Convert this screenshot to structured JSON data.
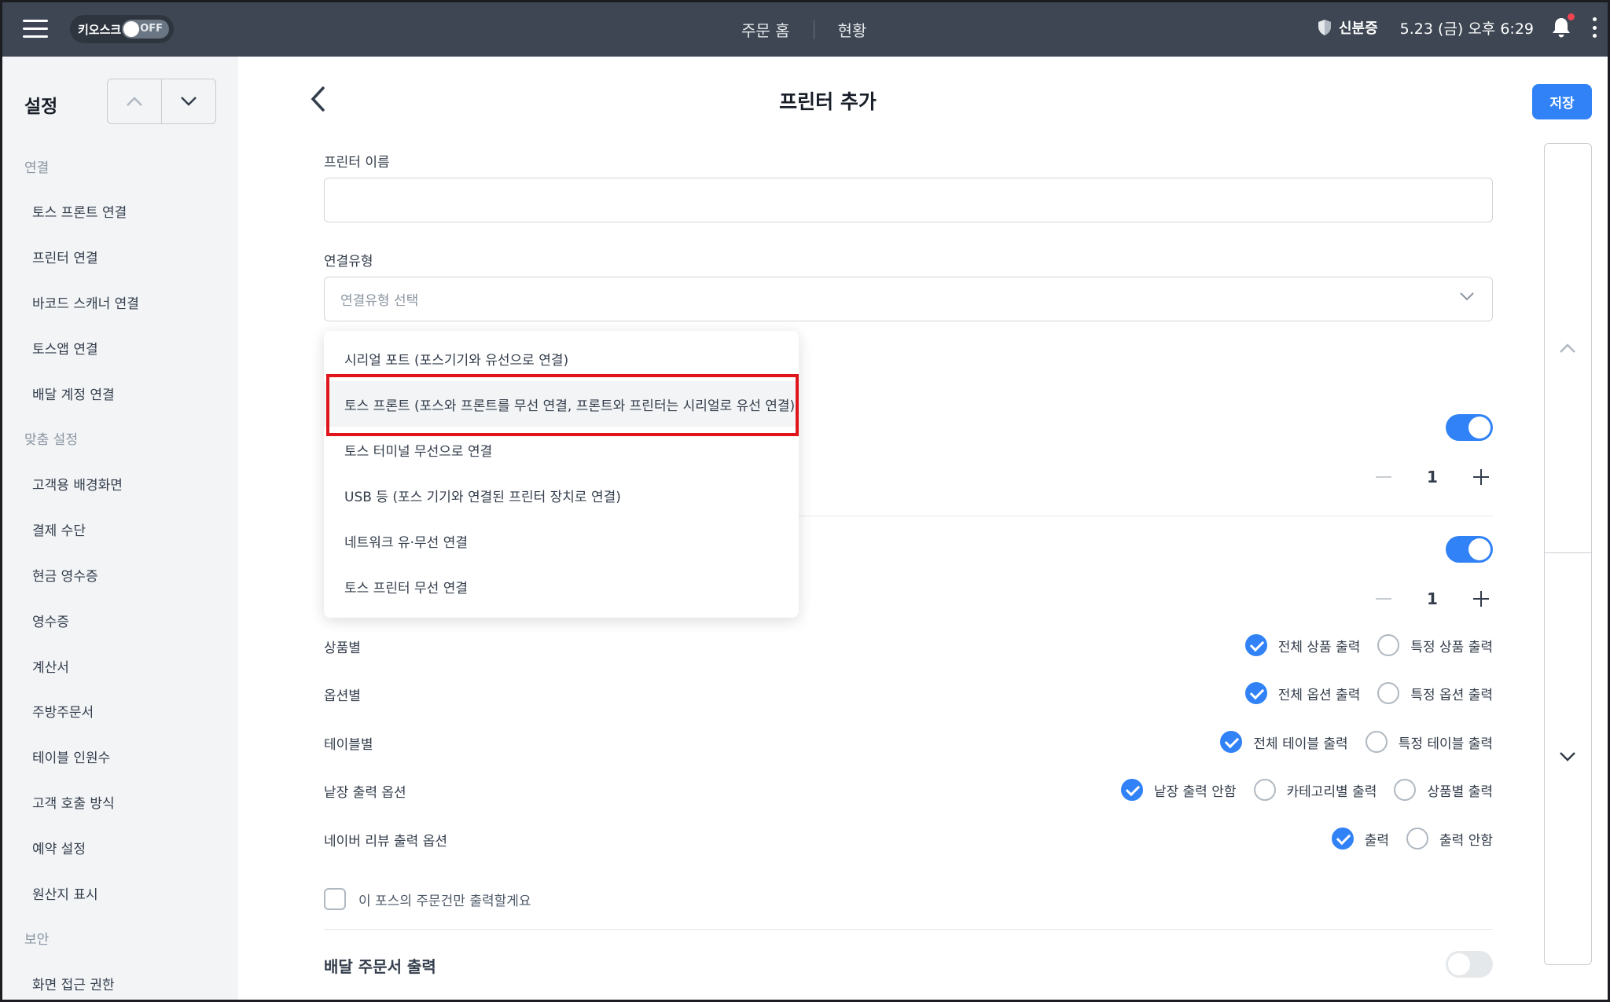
{
  "topbar": {
    "kiosk_label": "키오스크",
    "kiosk_state": "OFF",
    "nav": [
      "주문 홈",
      "현황"
    ],
    "id_verification": "신분증",
    "datetime": "5.23 (금) 오후 6:29"
  },
  "sidebar": {
    "title": "설정",
    "sections": [
      {
        "title": "연결",
        "items": [
          "토스 프론트 연결",
          "프린터 연결",
          "바코드 스캐너 연결",
          "토스앱 연결",
          "배달 계정 연결"
        ]
      },
      {
        "title": "맞춤 설정",
        "items": [
          "고객용 배경화면",
          "결제 수단",
          "현금 영수증",
          "영수증",
          "계산서",
          "주방주문서",
          "테이블 인원수",
          "고객 호출 방식",
          "예약 설정",
          "원산지 표시"
        ]
      },
      {
        "title": "보안",
        "items": [
          "화면 접근 권한"
        ]
      }
    ]
  },
  "main": {
    "title": "프린터 추가",
    "save_label": "저장",
    "printer_name_label": "프린터 이름",
    "printer_name_value": "",
    "connection_type_label": "연결유형",
    "connection_type_placeholder": "연결유형 선택",
    "dropdown_options": [
      "시리얼 포트 (포스기기와 유선으로 연결)",
      "토스 프론트 (포스와 프론트를 무선 연결, 프론트와 프린터는 시리얼로 유선 연결)",
      "토스 터미널 무선으로 연결",
      "USB 등 (포스 기기와 연결된 프린터 장치로 연결)",
      "네트워크 유·무선 연결",
      "토스 프린터 무선 연결"
    ],
    "highlighted_option_index": 1,
    "toggle_1_on": true,
    "stepper_1_value": "1",
    "toggle_2_on": true,
    "stepper_2_value": "1",
    "options": [
      {
        "label": "상품별",
        "choices": [
          "전체 상품 출력",
          "특정 상품 출력"
        ],
        "selected": 0
      },
      {
        "label": "옵션별",
        "choices": [
          "전체 옵션 출력",
          "특정 옵션 출력"
        ],
        "selected": 0
      },
      {
        "label": "테이블별",
        "choices": [
          "전체 테이블 출력",
          "특정 테이블 출력"
        ],
        "selected": 0
      },
      {
        "label": "낱장 출력 옵션",
        "choices": [
          "낱장 출력 안함",
          "카테고리별 출력",
          "상품별 출력"
        ],
        "selected": 0
      },
      {
        "label": "네이버 리뷰 출력 옵션",
        "choices": [
          "출력",
          "출력 안함"
        ],
        "selected": 0
      }
    ],
    "this_pos_only_label": "이 포스의 주문건만 출력할게요",
    "this_pos_only_checked": false,
    "delivery_label": "배달 주문서 출력",
    "delivery_on": false
  },
  "colors": {
    "topbar": "#3d4652",
    "accent": "#3182f6",
    "sidebar_bg": "#f2f4f6",
    "highlight_box": "#e0151b"
  }
}
